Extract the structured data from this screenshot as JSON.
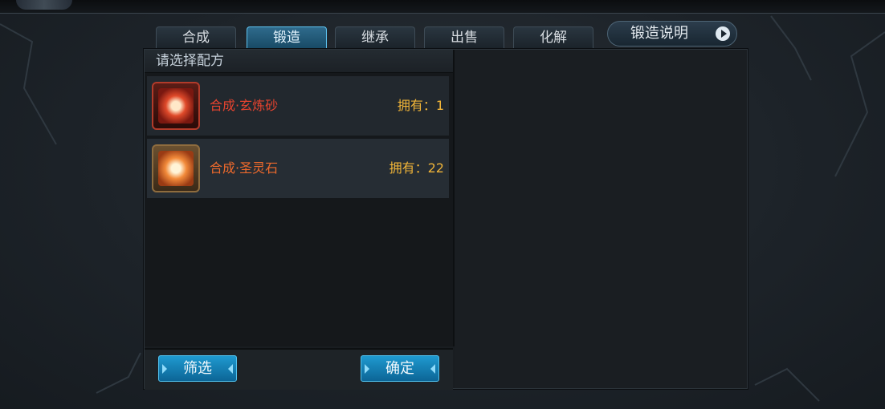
{
  "tabs": [
    {
      "label": "合成",
      "active": false
    },
    {
      "label": "锻造",
      "active": true
    },
    {
      "label": "继承",
      "active": false
    },
    {
      "label": "出售",
      "active": false
    },
    {
      "label": "化解",
      "active": false
    }
  ],
  "help_button": {
    "label": "锻造说明",
    "icon": "play-icon"
  },
  "recipe_panel": {
    "header": "请选择配方",
    "items": [
      {
        "name": "合成·玄炼砂",
        "owned": "拥有：1",
        "icon": "red-scroll-icon",
        "name_color": "#e5432f"
      },
      {
        "name": "合成·圣灵石",
        "owned": "拥有：22",
        "icon": "orange-scroll-icon",
        "name_color": "#ef6a2c"
      }
    ]
  },
  "footer": {
    "filter_label": "筛选",
    "confirm_label": "确定"
  },
  "colors": {
    "accent": "#1f9ad0",
    "owned_text": "#f0b438"
  }
}
